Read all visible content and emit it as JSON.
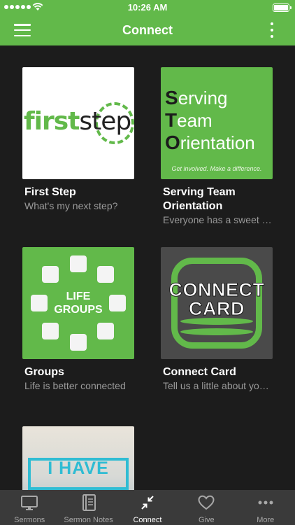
{
  "status_bar": {
    "time": "10:26 AM"
  },
  "nav": {
    "title": "Connect"
  },
  "cards": [
    {
      "title": "First Step",
      "subtitle": "What's my next step?",
      "image": {
        "word_a": "first",
        "word_b": "step"
      }
    },
    {
      "title": "Serving Team Orientation",
      "subtitle": "Everyone has a sweet spot",
      "image": {
        "lines": [
          {
            "cap": "S",
            "rest": "erving"
          },
          {
            "cap": "T",
            "rest": "eam"
          },
          {
            "cap": "O",
            "rest": "rientation"
          }
        ],
        "tagline": "Get involved. Make a difference."
      }
    },
    {
      "title": "Groups",
      "subtitle": "Life is better connected",
      "image": {
        "line1": "LIFE",
        "line2": "GROUPS"
      }
    },
    {
      "title": "Connect Card",
      "subtitle": "Tell us a little about yourself",
      "image": {
        "line1": "CONNECT",
        "line2": "CARD"
      }
    },
    {
      "title": "",
      "subtitle": "",
      "image": {
        "text": "I HAVE"
      }
    }
  ],
  "tabs": [
    {
      "label": "Sermons",
      "icon": "monitor-icon",
      "active": false
    },
    {
      "label": "Sermon Notes",
      "icon": "notebook-icon",
      "active": false
    },
    {
      "label": "Connect",
      "icon": "connect-arrows-icon",
      "active": true
    },
    {
      "label": "Give",
      "icon": "heart-icon",
      "active": false
    },
    {
      "label": "More",
      "icon": "more-dots-icon",
      "active": false
    }
  ],
  "colors": {
    "brand_green": "#62b94a",
    "background": "#1c1c1c",
    "tab_bar": "#3a3a3a",
    "subtitle_gray": "#9a9a9a"
  }
}
